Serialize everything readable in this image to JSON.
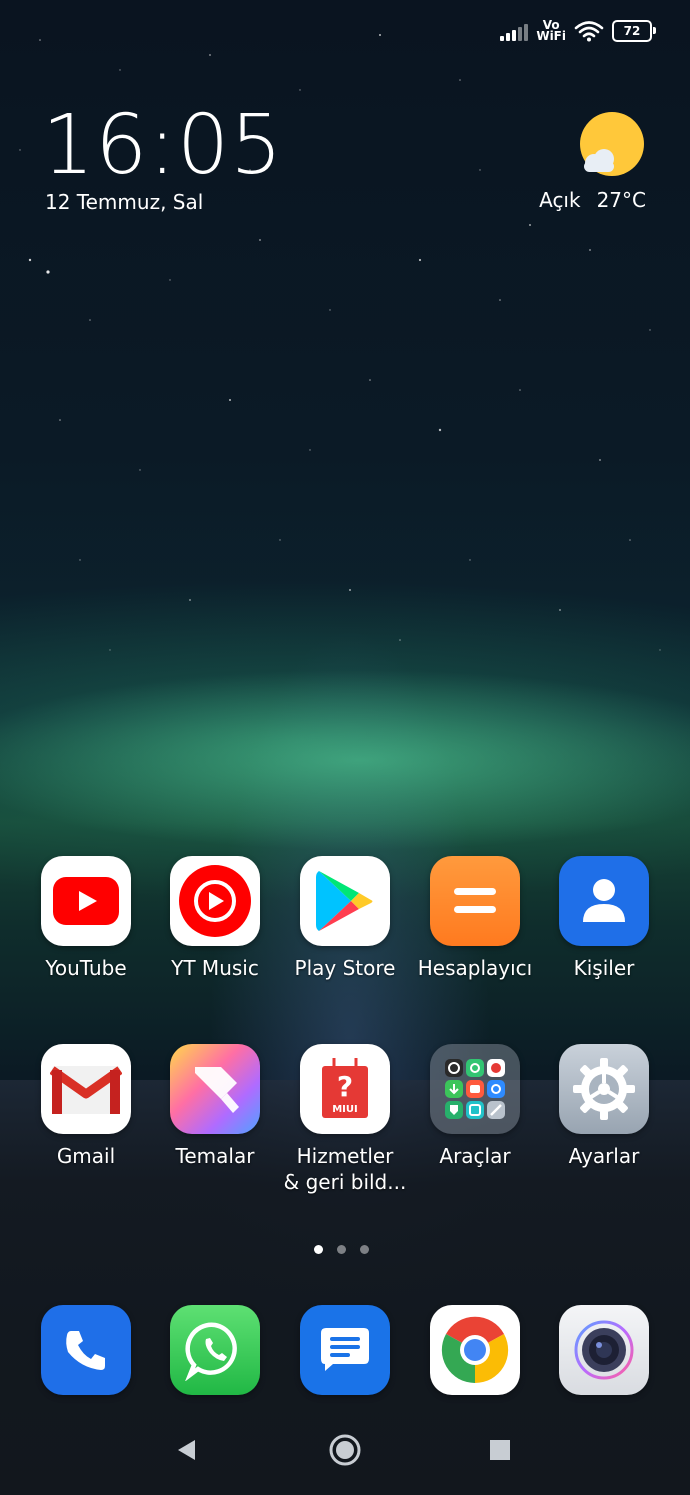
{
  "status_bar": {
    "vo_label": "Vo",
    "wifi_label": "WiFi",
    "battery_level": "72"
  },
  "clock": {
    "time": "16:05",
    "date": "12 Temmuz, Sal"
  },
  "weather": {
    "condition": "Açık",
    "temperature": "27°C",
    "icon": "sun-cloud-icon"
  },
  "apps_row1": [
    {
      "label": "YouTube",
      "icon": "youtube-icon"
    },
    {
      "label": "YT Music",
      "icon": "yt-music-icon"
    },
    {
      "label": "Play Store",
      "icon": "play-store-icon"
    },
    {
      "label": "Hesaplayıcı",
      "icon": "calculator-icon"
    },
    {
      "label": "Kişiler",
      "icon": "contacts-icon"
    }
  ],
  "apps_row2": [
    {
      "label": "Gmail",
      "icon": "gmail-icon"
    },
    {
      "label": "Temalar",
      "icon": "themes-icon"
    },
    {
      "label": "Hizmetler & geri bild...",
      "icon": "miui-services-icon"
    },
    {
      "label": "Araçlar",
      "icon": "tools-folder-icon"
    },
    {
      "label": "Ayarlar",
      "icon": "settings-icon"
    }
  ],
  "pages": {
    "count": 3,
    "active": 0
  },
  "dock": [
    {
      "icon": "phone-icon"
    },
    {
      "icon": "whatsapp-icon"
    },
    {
      "icon": "messages-icon"
    },
    {
      "icon": "chrome-icon"
    },
    {
      "icon": "camera-icon"
    }
  ],
  "nav": {
    "buttons": [
      "back-icon",
      "home-icon",
      "recents-icon"
    ]
  },
  "colors": {
    "youtube_red": "#ff0000",
    "calculator_orange": "#ff7a1f",
    "contacts_blue": "#1f6fe8",
    "whatsapp_green": "#25d366",
    "messages_blue": "#1a73e8"
  }
}
